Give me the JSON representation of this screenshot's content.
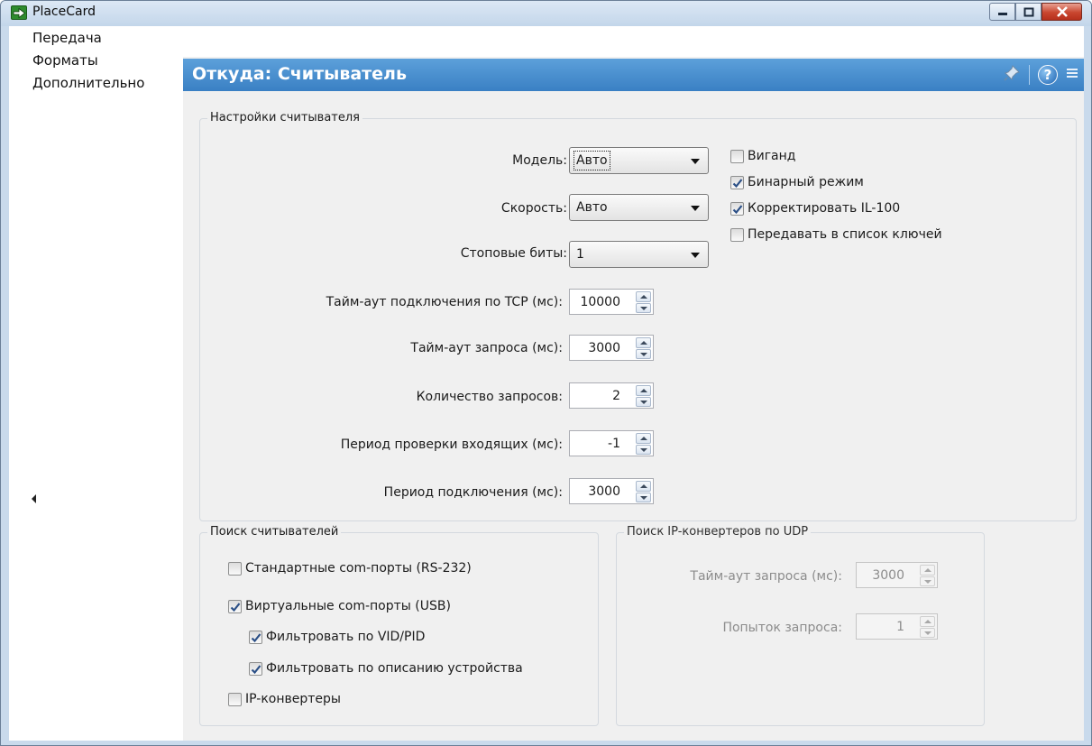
{
  "window": {
    "title": "PlaceCard"
  },
  "nav": {
    "items": [
      {
        "label": "Передача"
      },
      {
        "label": "Форматы"
      },
      {
        "label": "Дополнительно"
      }
    ]
  },
  "header": {
    "title": "Откуда: Считыватель"
  },
  "reader_settings": {
    "legend": "Настройки считывателя",
    "model": {
      "label": "Модель:",
      "value": "Авто"
    },
    "speed": {
      "label": "Скорость:",
      "value": "Авто"
    },
    "stop_bits": {
      "label": "Стоповые биты:",
      "value": "1"
    },
    "tcp_timeout": {
      "label": "Тайм-аут подключения по TCP (мс):",
      "value": "10000"
    },
    "request_timeout": {
      "label": "Тайм-аут запроса (мс):",
      "value": "3000"
    },
    "request_count": {
      "label": "Количество запросов:",
      "value": "2"
    },
    "incoming_period": {
      "label": "Период проверки входящих (мс):",
      "value": "-1"
    },
    "connect_period": {
      "label": "Период подключения (мс):",
      "value": "3000"
    },
    "options": [
      {
        "label": "Виганд",
        "checked": false
      },
      {
        "label": "Бинарный режим",
        "checked": true
      },
      {
        "label": "Корректировать IL-100",
        "checked": true
      },
      {
        "label": "Передавать в список ключей",
        "checked": false
      }
    ]
  },
  "reader_search": {
    "legend": "Поиск считывателей",
    "items": [
      {
        "label": "Стандартные com-порты (RS-232)",
        "checked": false
      },
      {
        "label": "Виртуальные com-порты (USB)",
        "checked": true
      },
      {
        "label": "Фильтровать по VID/PID",
        "checked": true
      },
      {
        "label": "Фильтровать по описанию устройства",
        "checked": true
      },
      {
        "label": "IP-конвертеры",
        "checked": false
      }
    ]
  },
  "udp_search": {
    "legend": "Поиск IP-конвертеров по UDP",
    "request_timeout": {
      "label": "Тайм-аут запроса (мс):",
      "value": "3000"
    },
    "attempts": {
      "label": "Попыток запроса:",
      "value": "1"
    }
  },
  "colors": {
    "header_bg": "#4a90d2",
    "pane_bg": "#f0f0f0",
    "close_button": "#c9462f"
  }
}
